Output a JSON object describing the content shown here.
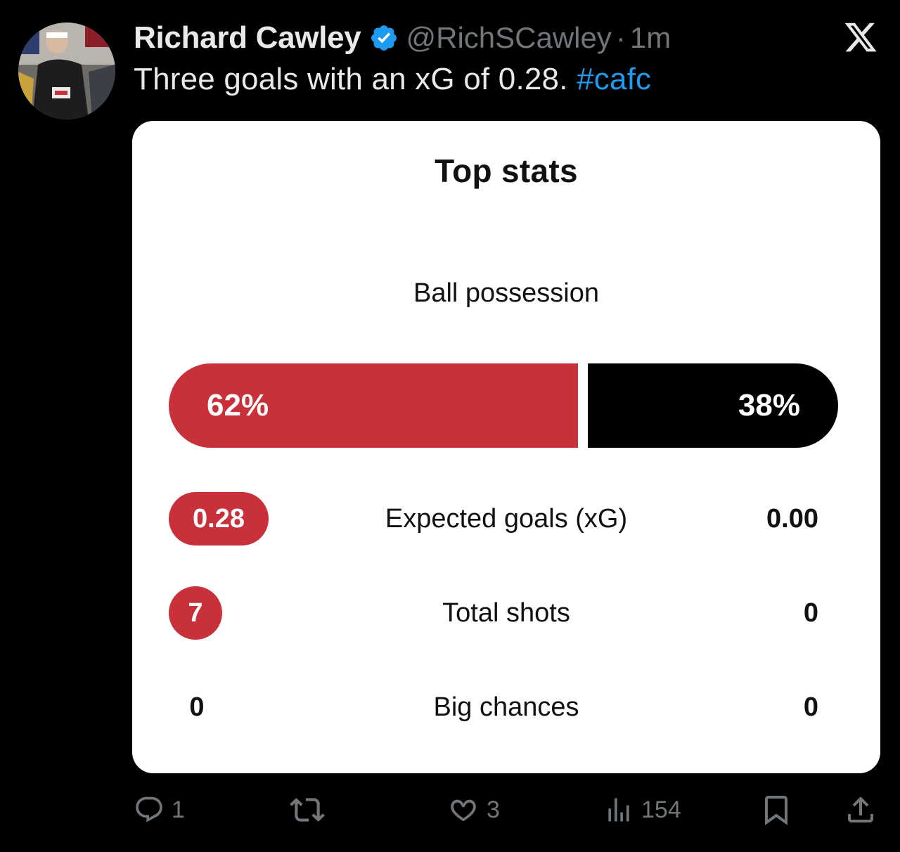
{
  "tweet": {
    "author_name": "Richard Cawley",
    "handle": "@RichSCawley",
    "separator": "·",
    "time": "1m",
    "text": "Three goals with an xG of 0.28.",
    "hashtag": "#cafc"
  },
  "card": {
    "title": "Top stats",
    "possession": {
      "label": "Ball possession",
      "home_text": "62%",
      "away_text": "38%",
      "home_percent": 62,
      "away_percent": 38
    },
    "stats": [
      {
        "label": "Expected goals (xG)",
        "home": "0.28",
        "away": "0.00"
      },
      {
        "label": "Total shots",
        "home": "7",
        "away": "0"
      },
      {
        "label": "Big chances",
        "home": "0",
        "away": "0"
      }
    ]
  },
  "actions": {
    "replies": "1",
    "likes": "3",
    "views": "154"
  },
  "icons": {
    "verified": "verified-badge-icon",
    "platform": "x-logo-icon",
    "reply": "reply-icon",
    "retweet": "retweet-icon",
    "like": "heart-icon",
    "views": "views-icon",
    "bookmark": "bookmark-icon",
    "share": "share-icon"
  },
  "colors": {
    "accent_red": "#c8303a",
    "link_blue": "#1d9bf0",
    "verified_blue": "#1d9bf0",
    "muted_gray": "#71767b"
  }
}
